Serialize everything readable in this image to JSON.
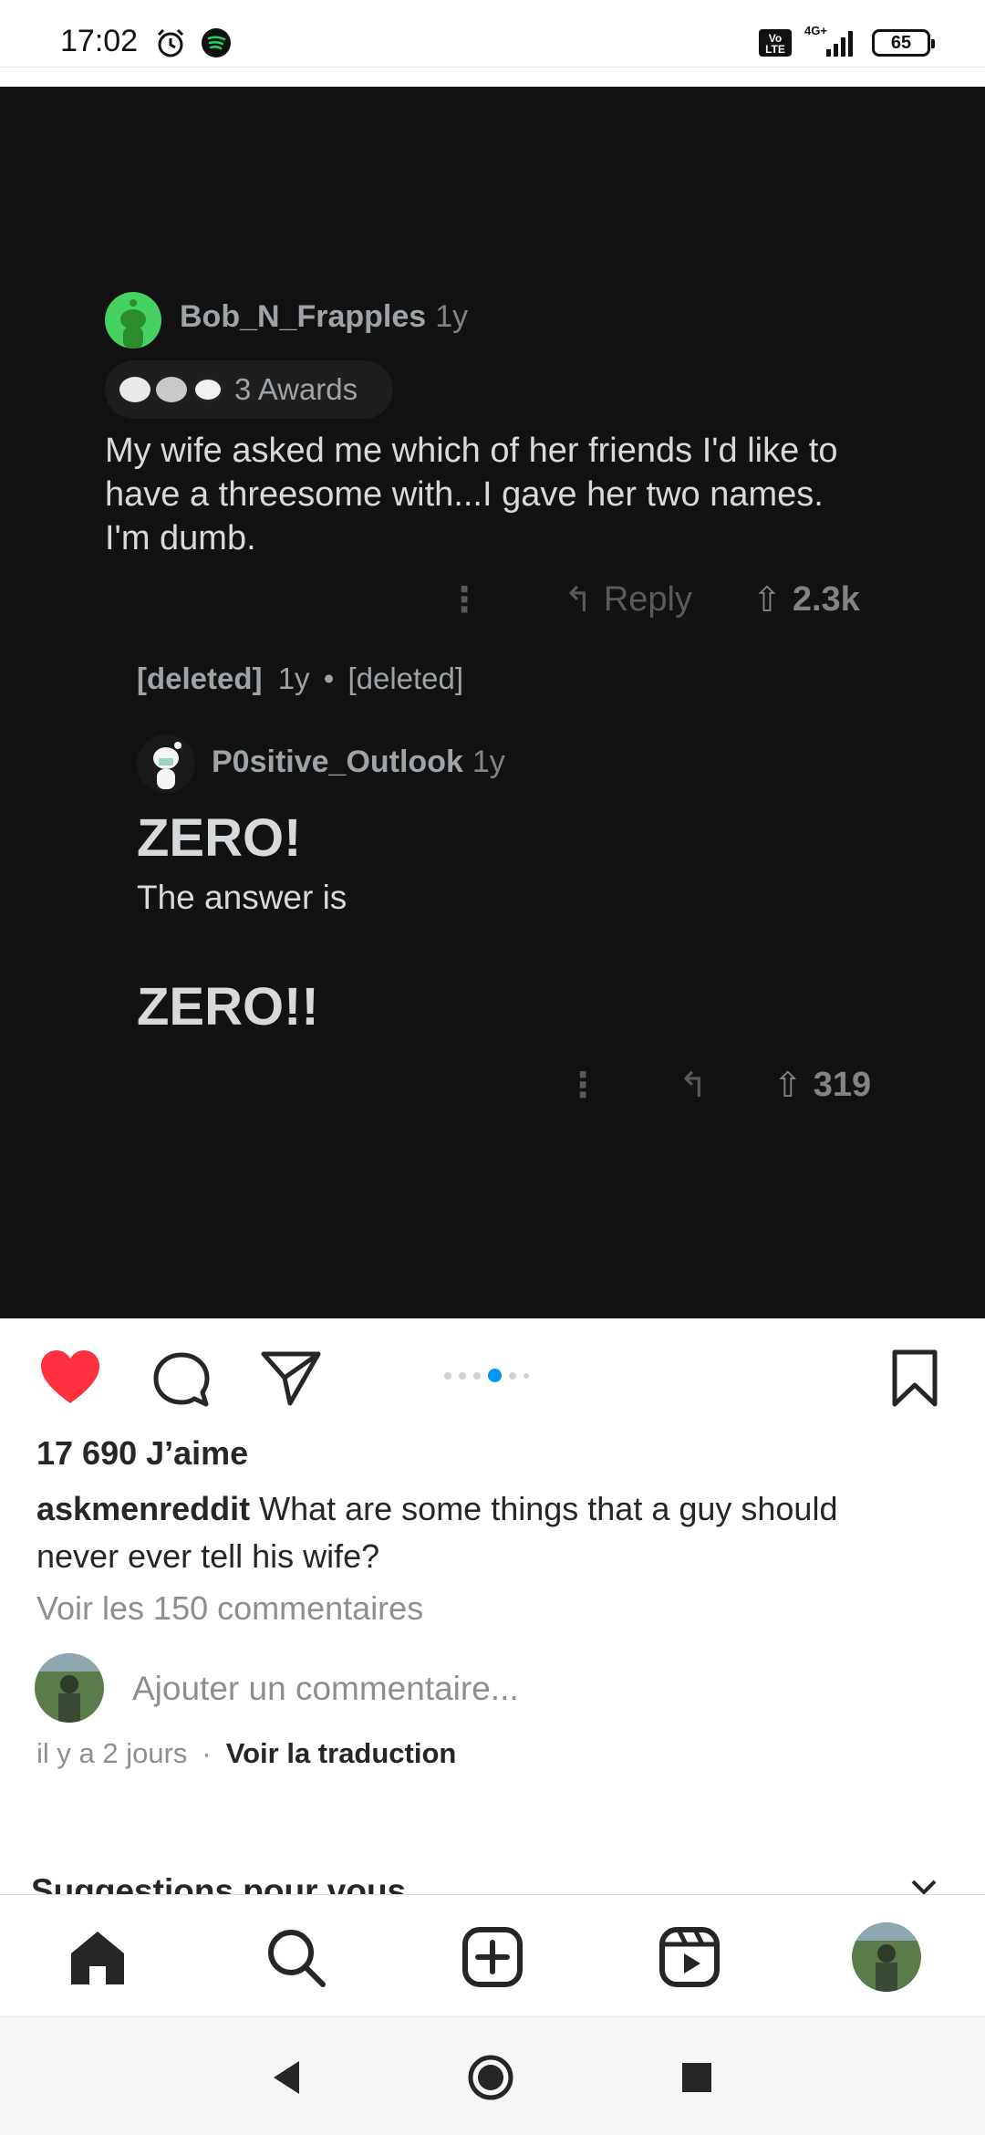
{
  "status_bar": {
    "time": "17:02",
    "network": "4G+",
    "battery": "65"
  },
  "post_image": {
    "comment1": {
      "username": "Bob_N_Frapples",
      "age": "1y",
      "awards": "3 Awards",
      "body": "My wife asked me which of her friends I'd like to have a threesome with...I gave her two names. I'm dumb.",
      "reply": "Reply",
      "score": "2.3k"
    },
    "deleted": {
      "user": "[deleted]",
      "age": "1y",
      "sep": "•",
      "body": "[deleted]"
    },
    "comment2": {
      "username": "P0sitive_Outlook",
      "age": "1y",
      "heading": "ZERO!",
      "line": "The answer is",
      "heading2": "ZERO!!",
      "score": "319"
    }
  },
  "post": {
    "likes": "17 690 J’aime",
    "author": "askmenreddit",
    "caption": "What are some things that a guy should never ever tell his wife?",
    "view_comments": "Voir les 150 commentaires",
    "add_comment_placeholder": "Ajouter un commentaire...",
    "time_ago": "il y a 2 jours",
    "separator": "·",
    "translate": "Voir la traduction",
    "carousel_index": 4,
    "carousel_count": 6
  },
  "suggestions": {
    "title": "Suggestions pour vous"
  },
  "icons": {
    "like": "heart-filled-icon",
    "comment": "comment-icon",
    "share": "paper-plane-icon",
    "save": "bookmark-icon"
  },
  "colors": {
    "like_red": "#ff3040",
    "carousel_blue": "#0095f6",
    "reddit_dark": "#121212"
  }
}
